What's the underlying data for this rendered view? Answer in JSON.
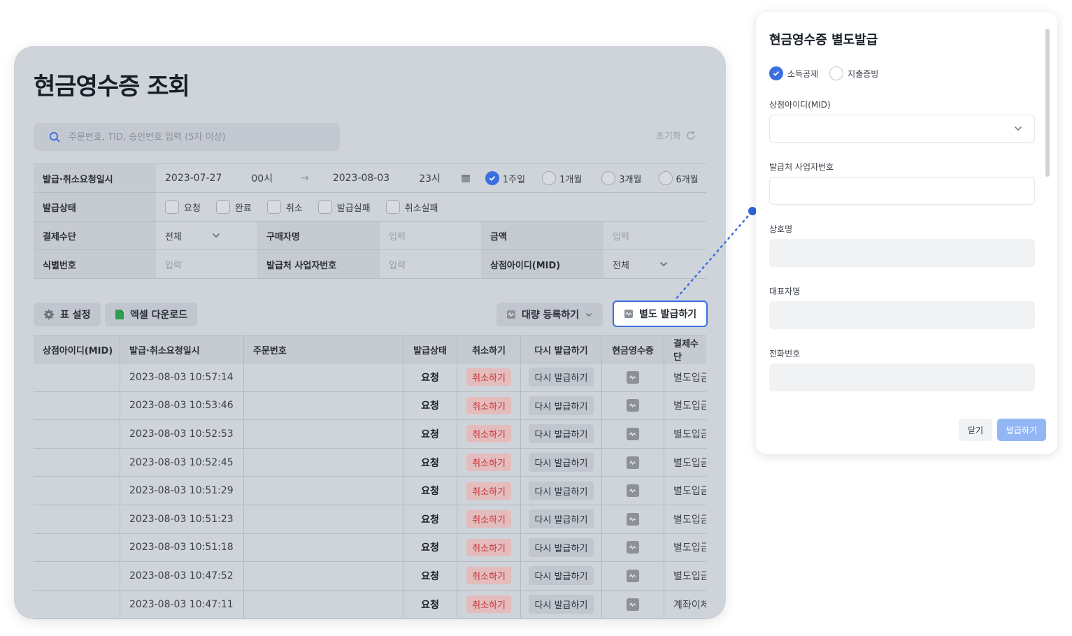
{
  "main": {
    "title": "현금영수증 조회",
    "search_placeholder": "주문번호, TID, 승인번호 입력 (5자 이상)",
    "reset_label": "초기화"
  },
  "filters": {
    "date_label": "발급·취소요청일시",
    "start_date": "2023-07-27",
    "start_hour": "00시",
    "end_date": "2023-08-03",
    "end_hour": "23시",
    "periods": [
      {
        "label": "1주일",
        "selected": true
      },
      {
        "label": "1개월",
        "selected": false
      },
      {
        "label": "3개월",
        "selected": false
      },
      {
        "label": "6개월",
        "selected": false
      }
    ],
    "status_label": "발급상태",
    "statuses": [
      "요청",
      "완료",
      "취소",
      "발급실패",
      "취소실패"
    ],
    "payment_label": "결제수단",
    "payment_value": "전체",
    "buyer_label": "구매자명",
    "buyer_placeholder": "입력",
    "amount_label": "금액",
    "amount_placeholder": "입력",
    "id_label": "식별번호",
    "id_placeholder": "입력",
    "biz_label": "발급처 사업자번호",
    "biz_placeholder": "입력",
    "mid_label": "상점아이디(MID)",
    "mid_value": "전체"
  },
  "toolbar": {
    "table_settings": "표 설정",
    "excel_download": "엑셀 다운로드",
    "bulk_register": "대량 등록하기",
    "separate_issue": "별도 발급하기"
  },
  "table": {
    "headers": [
      "상점아이디(MID)",
      "발급·취소요청일시",
      "주문번호",
      "발급상태",
      "취소하기",
      "다시 발급하기",
      "현금영수증",
      "결제수단"
    ],
    "rows": [
      {
        "mid": "",
        "datetime": "2023-08-03 10:57:14",
        "order": "",
        "status": "요청",
        "cancel": "취소하기",
        "reissue": "다시 발급하기",
        "method": "별도입금"
      },
      {
        "mid": "",
        "datetime": "2023-08-03 10:53:46",
        "order": "",
        "status": "요청",
        "cancel": "취소하기",
        "reissue": "다시 발급하기",
        "method": "별도입금"
      },
      {
        "mid": "",
        "datetime": "2023-08-03 10:52:53",
        "order": "",
        "status": "요청",
        "cancel": "취소하기",
        "reissue": "다시 발급하기",
        "method": "별도입금"
      },
      {
        "mid": "",
        "datetime": "2023-08-03 10:52:45",
        "order": "",
        "status": "요청",
        "cancel": "취소하기",
        "reissue": "다시 발급하기",
        "method": "별도입금"
      },
      {
        "mid": "",
        "datetime": "2023-08-03 10:51:29",
        "order": "",
        "status": "요청",
        "cancel": "취소하기",
        "reissue": "다시 발급하기",
        "method": "별도입금"
      },
      {
        "mid": "",
        "datetime": "2023-08-03 10:51:23",
        "order": "",
        "status": "요청",
        "cancel": "취소하기",
        "reissue": "다시 발급하기",
        "method": "별도입금"
      },
      {
        "mid": "",
        "datetime": "2023-08-03 10:51:18",
        "order": "",
        "status": "요청",
        "cancel": "취소하기",
        "reissue": "다시 발급하기",
        "method": "별도입금"
      },
      {
        "mid": "",
        "datetime": "2023-08-03 10:47:52",
        "order": "",
        "status": "요청",
        "cancel": "취소하기",
        "reissue": "다시 발급하기",
        "method": "별도입금"
      },
      {
        "mid": "",
        "datetime": "2023-08-03 10:47:11",
        "order": "",
        "status": "요청",
        "cancel": "취소하기",
        "reissue": "다시 발급하기",
        "method": "계좌이체"
      }
    ]
  },
  "side_panel": {
    "title": "현금영수증 별도발급",
    "types": [
      {
        "label": "소득공제",
        "selected": true
      },
      {
        "label": "지출증빙",
        "selected": false
      }
    ],
    "fields": {
      "mid": "상점아이디(MID)",
      "biz_number": "발급처 사업자번호",
      "company": "상호명",
      "ceo": "대표자명",
      "phone": "전화번호"
    },
    "close": "닫기",
    "issue": "발급하기"
  },
  "colors": {
    "accent": "#3a6fe0",
    "cancel_text": "#c8313a",
    "issue_button": "#93b6f5"
  }
}
